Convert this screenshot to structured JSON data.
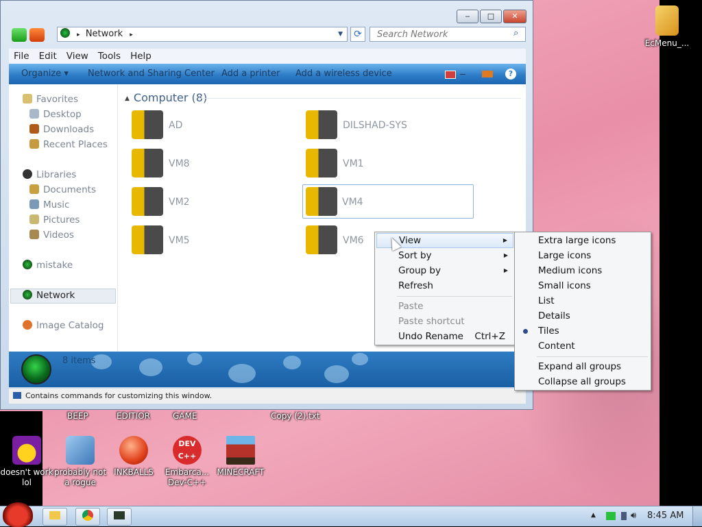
{
  "desktop": {
    "top_icon": {
      "label": "EcMenu_..."
    },
    "top_labels": [
      "BEEP",
      "EDITIOR",
      "GAME",
      "Copy (2).txt"
    ],
    "icons": [
      {
        "label": "doesn't work lol"
      },
      {
        "label": "probably not a rogue"
      },
      {
        "label": "INKBALLS"
      },
      {
        "label": "Embarca... Dev-C++"
      },
      {
        "label": "MINECRAFT"
      }
    ]
  },
  "window": {
    "caption_buttons": {
      "minimize": "‒",
      "maximize": "□",
      "close": "✕"
    },
    "address": {
      "path": "Network",
      "separator": "▸"
    },
    "search_placeholder": "Search Network",
    "menubar": [
      "File",
      "Edit",
      "View",
      "Tools",
      "Help"
    ],
    "commands": [
      "Organize ▾",
      "Network and Sharing Center",
      "Add a printer",
      "Add a wireless device"
    ],
    "help_icon": "?",
    "nav": {
      "favorites": "Favorites",
      "desktop": "Desktop",
      "downloads": "Downloads",
      "recent": "Recent Places",
      "libraries": "Libraries",
      "documents": "Documents",
      "music": "Music",
      "pictures": "Pictures",
      "videos": "Videos",
      "mistake": "mistake",
      "network": "Network",
      "catalog": "Image Catalog"
    },
    "group_header": "Computer (8)",
    "computers": [
      "AD",
      "DILSHAD-SYS",
      "VM8",
      "VM1",
      "VM2",
      "VM4",
      "VM5",
      "VM6"
    ],
    "status_count": "8 items",
    "tip": "Contains commands for customizing this window."
  },
  "context_menu": {
    "view": "View",
    "sort_by": "Sort by",
    "group_by": "Group by",
    "refresh": "Refresh",
    "paste": "Paste",
    "paste_shortcut": "Paste shortcut",
    "undo_rename": "Undo Rename",
    "undo_shortcut": "Ctrl+Z"
  },
  "view_submenu": {
    "extra_large": "Extra large icons",
    "large": "Large icons",
    "medium": "Medium icons",
    "small": "Small icons",
    "list": "List",
    "details": "Details",
    "tiles": "Tiles",
    "content": "Content",
    "expand": "Expand all groups",
    "collapse": "Collapse all groups",
    "selected": "Tiles"
  },
  "taskbar": {
    "clock": "8:45 AM"
  },
  "colors": {
    "accent": "#2e7dc8",
    "highlight": "#dce9f8"
  }
}
